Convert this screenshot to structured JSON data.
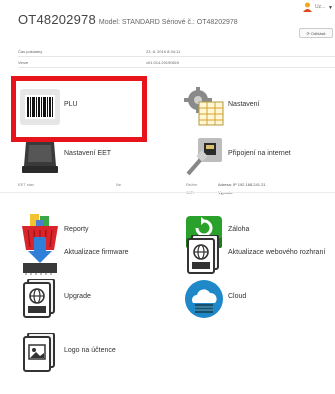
{
  "header": {
    "device_id": "OT48202978",
    "model_line": "Model: STANDARD Sériové č.: OT48202978",
    "user_name": "Uz...",
    "action_button": "Odhlásit"
  },
  "info_rows": [
    {
      "label": "Čas pokladny",
      "value": "23. 8. 2019 8:34:11"
    },
    {
      "label": "Verze",
      "value": "v01.014.20190819"
    }
  ],
  "tiles": {
    "plu": "PLU",
    "settings": "Nastavení",
    "eet_settings": "Nastavení EET",
    "internet": "Připojení na internet",
    "reports": "Reporty",
    "backup": "Záloha",
    "firmware_update": "Aktualizace firmware",
    "web_update": "Aktualizace webového rozhraní",
    "upgrade": "Upgrade",
    "cloud": "Cloud",
    "receipt_logo": "Logo na účtence"
  },
  "eet_info": {
    "label": "EET stav",
    "value": "Ne"
  },
  "net_info": [
    {
      "label": "Režim",
      "value": "Adresa: IP 192.168.241.21"
    },
    {
      "label": "WiFi",
      "value": "Vypnuto"
    }
  ],
  "colors": {
    "highlight": "#e8141c",
    "backup_green": "#2aa12a",
    "cloud_blue": "#1e88c8"
  }
}
